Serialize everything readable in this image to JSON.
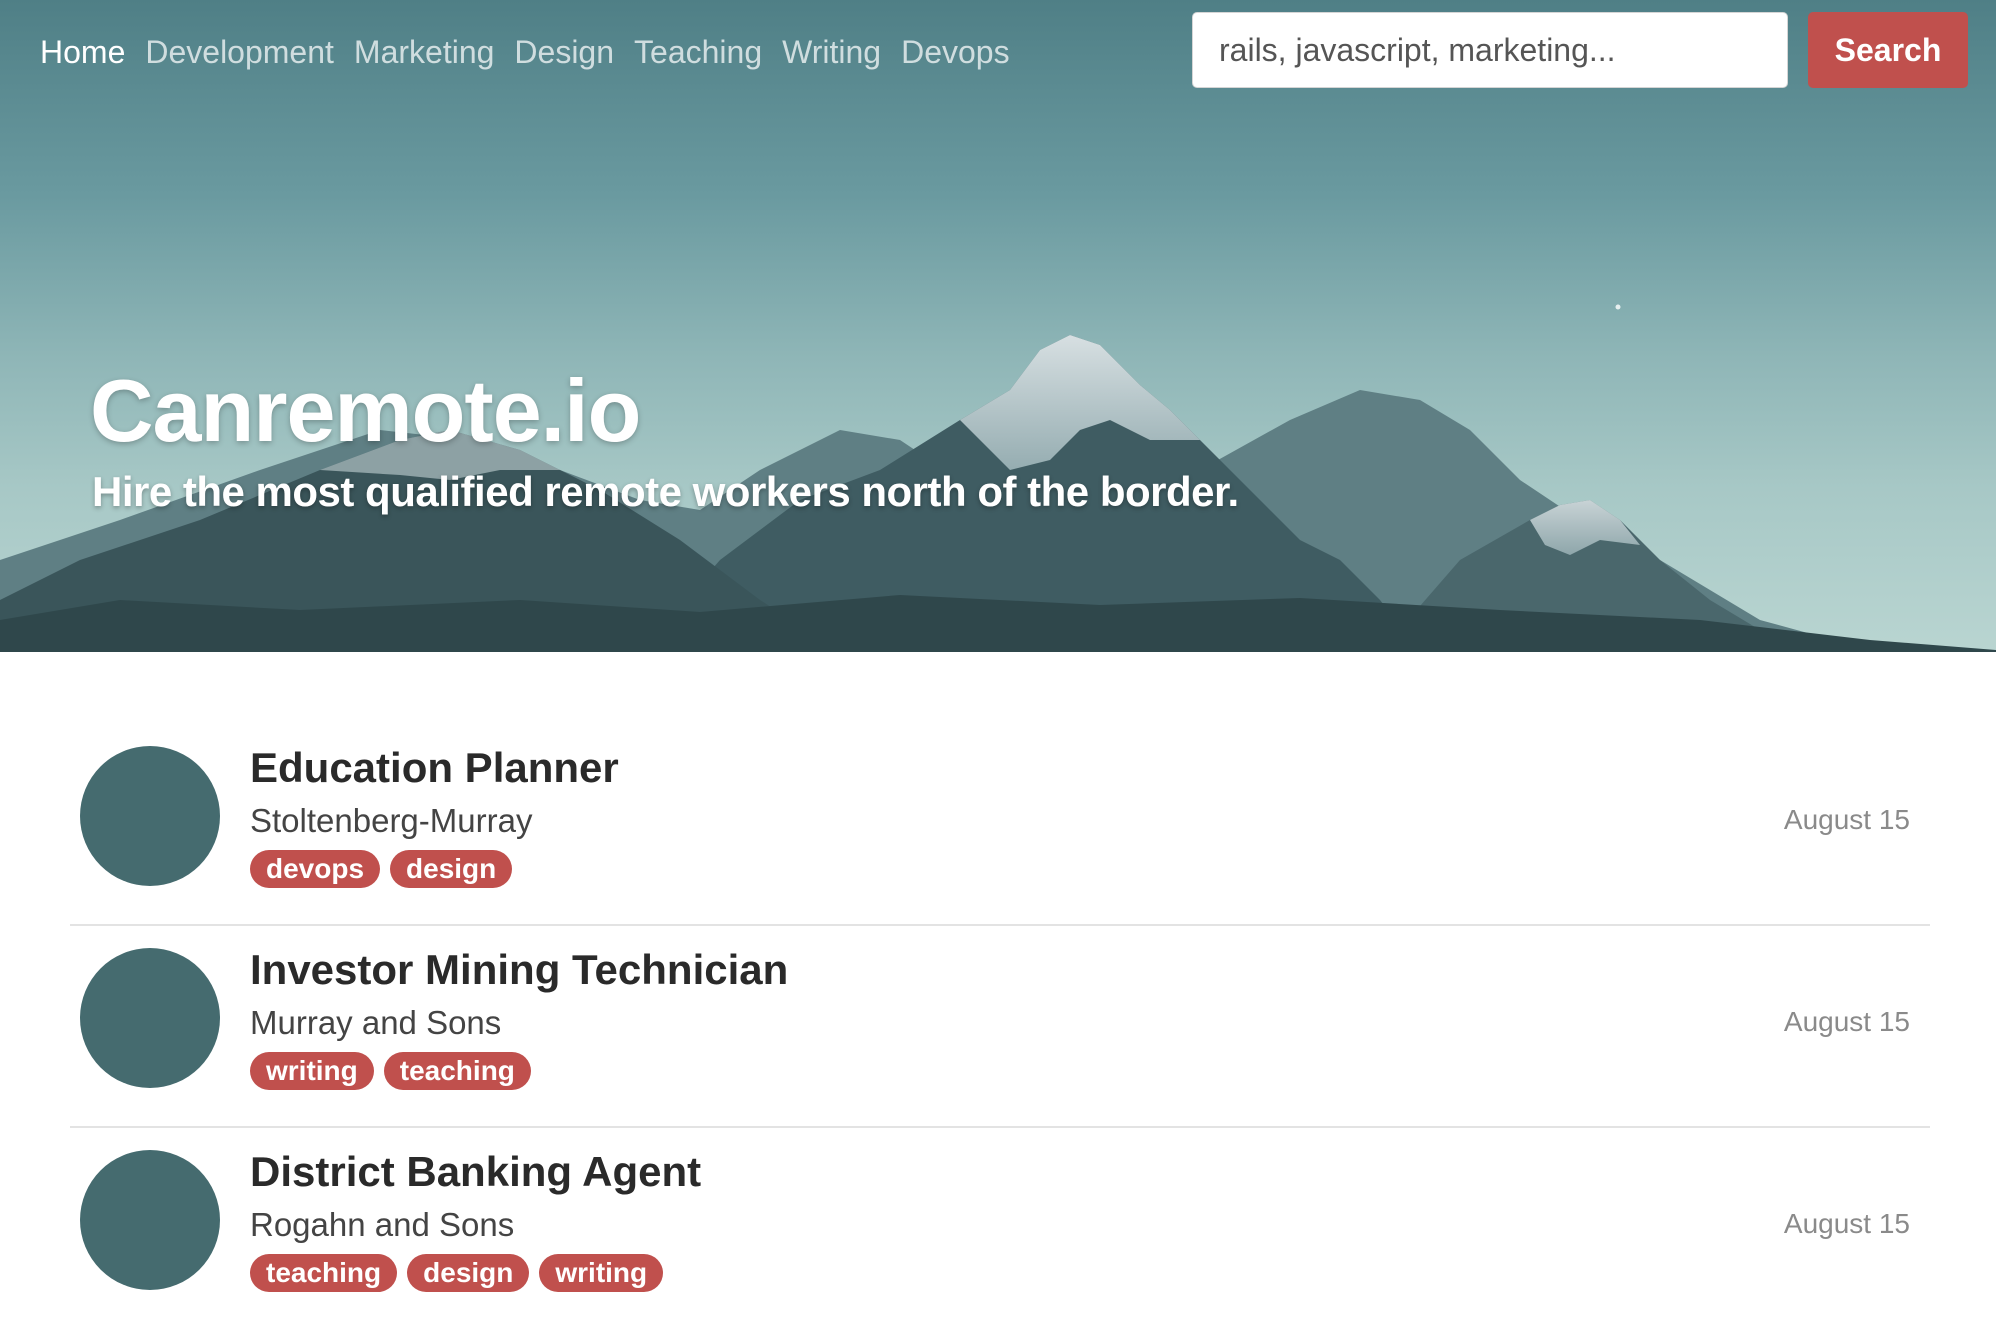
{
  "nav": {
    "items": [
      {
        "label": "Home",
        "active": true
      },
      {
        "label": "Development",
        "active": false
      },
      {
        "label": "Marketing",
        "active": false
      },
      {
        "label": "Design",
        "active": false
      },
      {
        "label": "Teaching",
        "active": false
      },
      {
        "label": "Writing",
        "active": false
      },
      {
        "label": "Devops",
        "active": false
      }
    ]
  },
  "search": {
    "placeholder": "rails, javascript, marketing...",
    "button_label": "Search"
  },
  "hero": {
    "title": "Canremote.io",
    "subtitle": "Hire the most qualified remote workers north of the border."
  },
  "colors": {
    "accent": "#c0504d",
    "avatar": "#456b6f"
  },
  "jobs": [
    {
      "title": "Education Planner",
      "company": "Stoltenberg-Murray",
      "tags": [
        "devops",
        "design"
      ],
      "date": "August 15"
    },
    {
      "title": "Investor Mining Technician",
      "company": "Murray and Sons",
      "tags": [
        "writing",
        "teaching"
      ],
      "date": "August 15"
    },
    {
      "title": "District Banking Agent",
      "company": "Rogahn and Sons",
      "tags": [
        "teaching",
        "design",
        "writing"
      ],
      "date": "August 15"
    }
  ]
}
